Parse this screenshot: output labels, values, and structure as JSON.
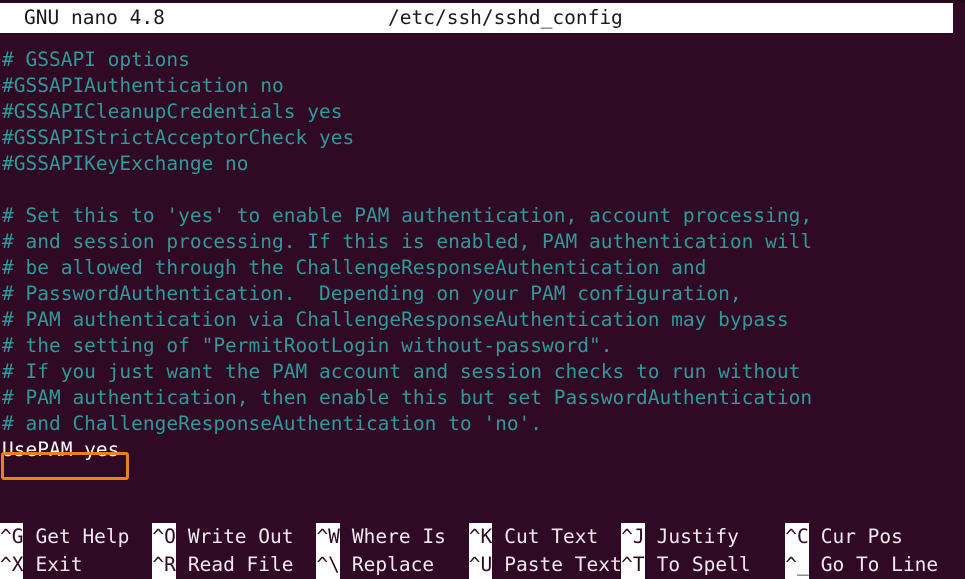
{
  "window": {
    "background_color": "#300a24",
    "comment_color": "#2e9a9a",
    "text_color": "#ffffff",
    "highlight_color": "#e8821e",
    "titlebar_bg": "#ffffff",
    "titlebar_fg": "#1a1a1a"
  },
  "titlebar": {
    "version": "GNU nano 4.8",
    "filepath": "/etc/ssh/sshd_config"
  },
  "editor": {
    "lines": [
      {
        "text": "# GSSAPI options",
        "type": "comment"
      },
      {
        "text": "#GSSAPIAuthentication no",
        "type": "comment"
      },
      {
        "text": "#GSSAPICleanupCredentials yes",
        "type": "comment"
      },
      {
        "text": "#GSSAPIStrictAcceptorCheck yes",
        "type": "comment"
      },
      {
        "text": "#GSSAPIKeyExchange no",
        "type": "comment"
      },
      {
        "text": "",
        "type": "blank"
      },
      {
        "text": "# Set this to 'yes' to enable PAM authentication, account processing,",
        "type": "comment"
      },
      {
        "text": "# and session processing. If this is enabled, PAM authentication will",
        "type": "comment"
      },
      {
        "text": "# be allowed through the ChallengeResponseAuthentication and",
        "type": "comment"
      },
      {
        "text": "# PasswordAuthentication.  Depending on your PAM configuration,",
        "type": "comment"
      },
      {
        "text": "# PAM authentication via ChallengeResponseAuthentication may bypass",
        "type": "comment"
      },
      {
        "text": "# the setting of \"PermitRootLogin without-password\".",
        "type": "comment"
      },
      {
        "text": "# If you just want the PAM account and session checks to run without",
        "type": "comment"
      },
      {
        "text": "# PAM authentication, then enable this but set PasswordAuthentication",
        "type": "comment"
      },
      {
        "text": "# and ChallengeResponseAuthentication to 'no'.",
        "type": "comment"
      },
      {
        "text": "UsePAM yes",
        "type": "current"
      }
    ]
  },
  "highlight": {
    "target_text": "UsePAM yes"
  },
  "shortcuts": {
    "row1": [
      {
        "key": "^G",
        "label": "Get Help"
      },
      {
        "key": "^O",
        "label": "Write Out"
      },
      {
        "key": "^W",
        "label": "Where Is"
      },
      {
        "key": "^K",
        "label": "Cut Text"
      },
      {
        "key": "^J",
        "label": "Justify"
      },
      {
        "key": "^C",
        "label": "Cur Pos"
      }
    ],
    "row2": [
      {
        "key": "^X",
        "label": "Exit"
      },
      {
        "key": "^R",
        "label": "Read File"
      },
      {
        "key": "^\\",
        "label": "Replace"
      },
      {
        "key": "^U",
        "label": "Paste Text"
      },
      {
        "key": "^T",
        "label": "To Spell"
      },
      {
        "key": "^_",
        "label": "Go To Line"
      }
    ]
  }
}
